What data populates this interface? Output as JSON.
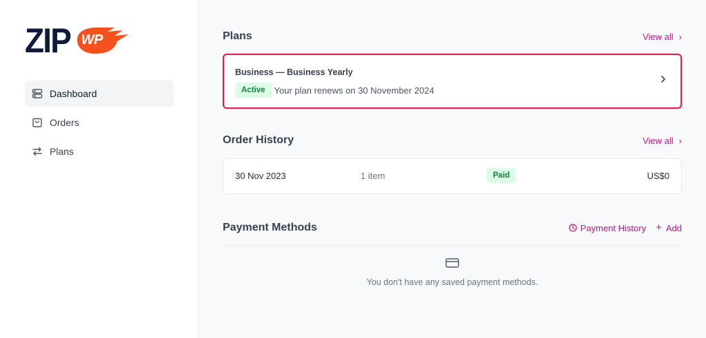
{
  "brand": {
    "logo_left": "ZIP",
    "logo_right": "WP",
    "accent": "#c0148a",
    "logo_orange": "#f4511e"
  },
  "sidebar": {
    "items": [
      {
        "label": "Dashboard",
        "icon": "server-icon",
        "active": true
      },
      {
        "label": "Orders",
        "icon": "shopping-bag-icon",
        "active": false
      },
      {
        "label": "Plans",
        "icon": "arrows-repeat-icon",
        "active": false
      }
    ]
  },
  "plans": {
    "title": "Plans",
    "view_all": "View all",
    "current": {
      "name": "Business — Business Yearly",
      "status": "Active",
      "renewal": "Your plan renews on 30 November 2024"
    }
  },
  "orders": {
    "title": "Order History",
    "view_all": "View all",
    "rows": [
      {
        "date": "30 Nov 2023",
        "items": "1 item",
        "status": "Paid",
        "amount": "US$0"
      }
    ]
  },
  "payment": {
    "title": "Payment Methods",
    "history_label": "Payment History",
    "add_label": "Add",
    "empty": "You don't have any saved payment methods."
  }
}
